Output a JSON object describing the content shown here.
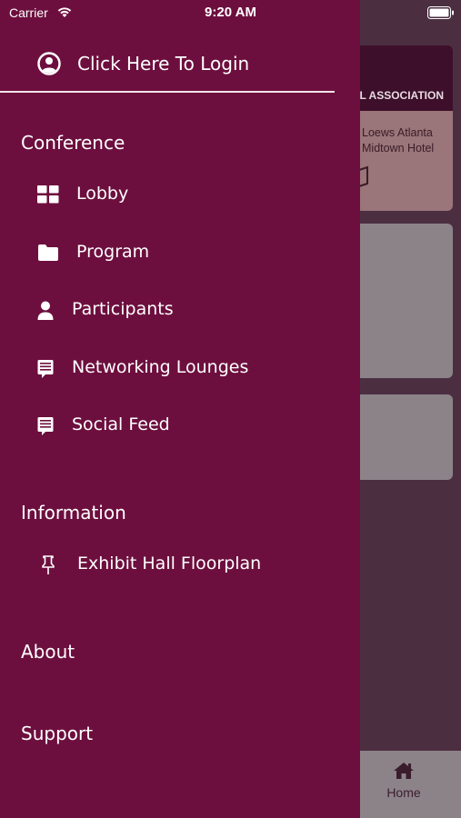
{
  "status_bar": {
    "carrier": "Carrier",
    "time": "9:20 AM"
  },
  "drawer": {
    "login_label": "Click Here To Login",
    "sections": {
      "conference": {
        "title": "Conference",
        "items": [
          {
            "label": "Lobby",
            "icon": "grid-icon"
          },
          {
            "label": "Program",
            "icon": "folder-icon"
          },
          {
            "label": "Participants",
            "icon": "person-icon"
          },
          {
            "label": "Networking Lounges",
            "icon": "chat-icon"
          },
          {
            "label": "Social Feed",
            "icon": "chat-icon"
          }
        ]
      },
      "information": {
        "title": "Information",
        "items": [
          {
            "label": "Exhibit Hall Floorplan",
            "icon": "pin-icon"
          }
        ]
      },
      "about": {
        "title": "About"
      },
      "support": {
        "title": "Support"
      }
    }
  },
  "background": {
    "banner_text": "L ASSOCIATION",
    "venue_line1": "Loews Atlanta",
    "venue_line2": "Midtown Hotel",
    "home_tab_label": "Home"
  },
  "colors": {
    "drawer_bg": "#6d0f3e",
    "text": "#ffffff",
    "icon": "#ffffff"
  }
}
